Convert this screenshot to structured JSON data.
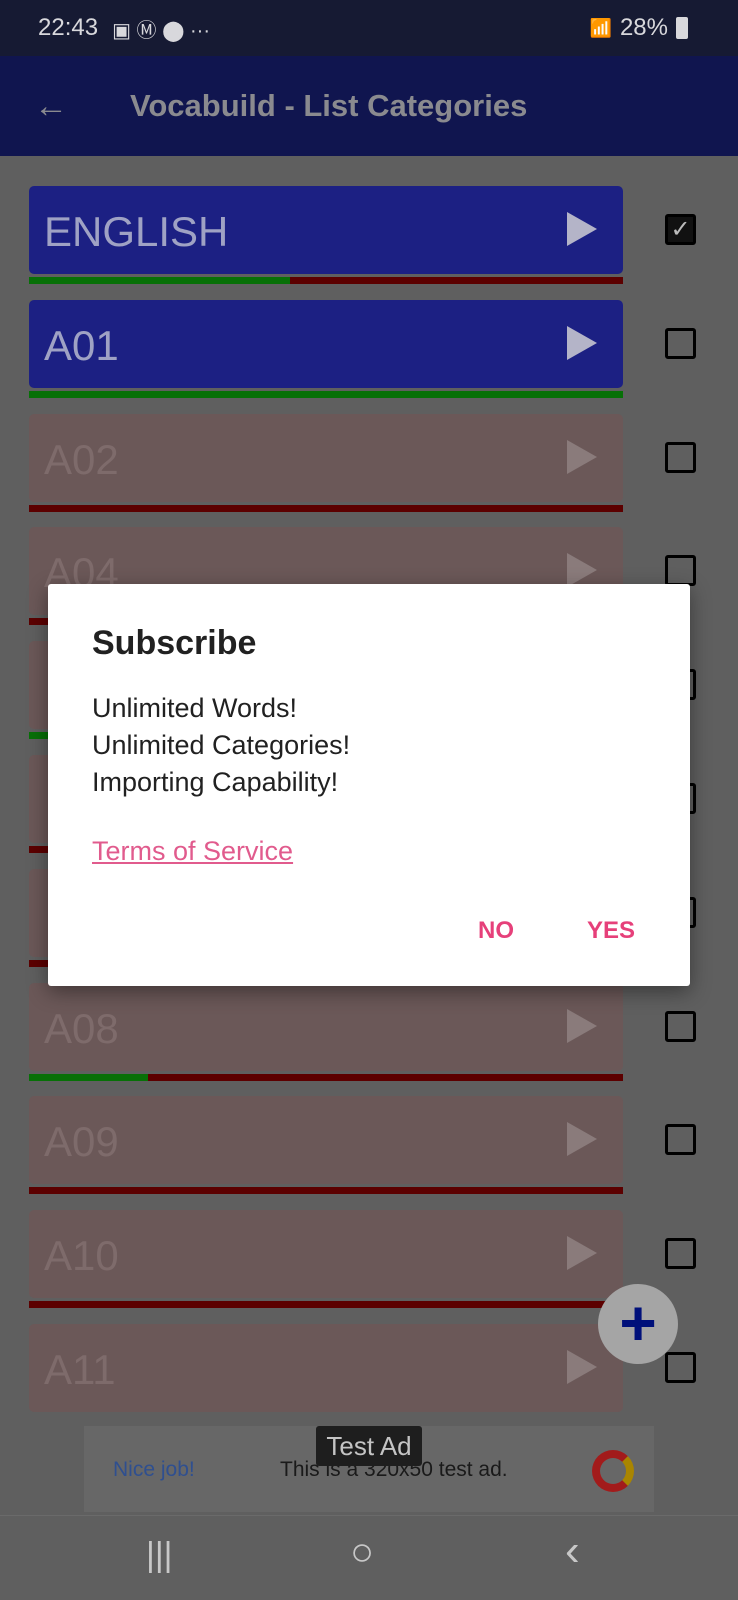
{
  "status_bar": {
    "time": "22:43",
    "battery": "28%",
    "icons": [
      "image-icon",
      "gmail-icon",
      "location-icon",
      "more-icon"
    ],
    "right_icons": [
      "wifi-icon",
      "signal-icon",
      "battery-icon"
    ]
  },
  "app_bar": {
    "title": "Vocabuild - List Categories",
    "back_icon": "arrow-left-icon"
  },
  "colors": {
    "active_row": "#1c2083",
    "inactive_row": "#6b5858",
    "progress_known": "#077007",
    "progress_unknown": "#5c0000",
    "accent": "#e6407a",
    "fab_plus": "#00107a"
  },
  "categories": [
    {
      "label": "ENGLISH",
      "active": true,
      "checked": true,
      "progress": 0.44
    },
    {
      "label": "A01",
      "active": true,
      "checked": false,
      "progress": 1.0
    },
    {
      "label": "A02",
      "active": false,
      "checked": false,
      "progress": 0
    },
    {
      "label": "A04",
      "active": false,
      "checked": false,
      "progress": 0
    },
    {
      "label": "",
      "active": false,
      "checked": false,
      "progress": 0.05
    },
    {
      "label": "",
      "active": false,
      "checked": false,
      "progress": 0
    },
    {
      "label": "",
      "active": false,
      "checked": false,
      "progress": 0
    },
    {
      "label": "A08",
      "active": false,
      "checked": false,
      "progress": 0.2
    },
    {
      "label": "A09",
      "active": false,
      "checked": false,
      "progress": 0
    },
    {
      "label": "A10",
      "active": false,
      "checked": false,
      "progress": 0
    },
    {
      "label": "A11",
      "active": false,
      "checked": false,
      "progress": null
    }
  ],
  "dialog": {
    "title": "Subscribe",
    "lines": [
      "Unlimited Words!",
      "Unlimited Categories!",
      "Importing Capability!"
    ],
    "link": "Terms of Service",
    "no": "NO",
    "yes": "YES"
  },
  "fab": {
    "icon": "plus-icon",
    "symbol": "+"
  },
  "ad": {
    "badge": "Test Ad",
    "headline": "Nice job!",
    "text": "This is a 320x50 test ad."
  },
  "nav": {
    "recents": "|||",
    "home": "○",
    "back": "‹"
  }
}
